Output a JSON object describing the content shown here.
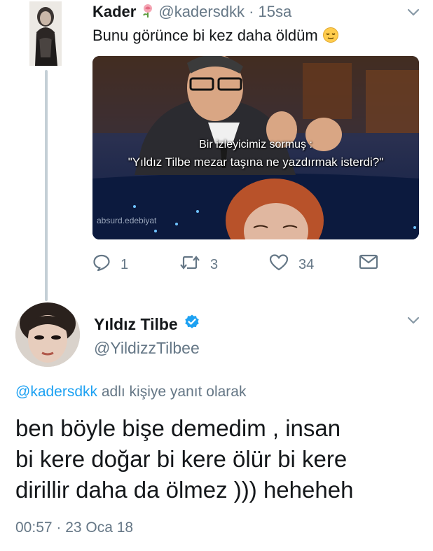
{
  "reply_tweet": {
    "author_name": "Kader",
    "author_handle": "@kadersdkk",
    "time_ago": "15sa",
    "text": "Bunu görünce bi kez daha öldüm",
    "name_emoji": "rose-icon",
    "text_emoji": "relieved-face-emoji",
    "media": {
      "caption_line1": "Bir izleyicimiz sormuş :",
      "caption_line2": "\"Yıldız Tilbe mezar taşına ne yazdırmak isterdi?\"",
      "watermark": "absurd.edebiyat"
    },
    "actions": {
      "reply_count": "1",
      "retweet_count": "3",
      "like_count": "34"
    }
  },
  "main_tweet": {
    "author_name": "Yıldız Tilbe",
    "author_handle": "@YildizzTilbee",
    "verified": true,
    "reply_to_handle": "@kadersdkk",
    "reply_to_suffix": " adlı kişiye yanıt olarak",
    "text": "ben böyle bişe demedim , insan\nbi kere doğar bi kere ölür bi kere\ndirillir daha da ölmez ))) heheheh",
    "timestamp": "00:57 · 23 Oca 18"
  },
  "colors": {
    "accent": "#1da1f2",
    "secondary_text": "#657786",
    "primary_text": "#14171a",
    "thread_line": "#c4cfd6"
  }
}
